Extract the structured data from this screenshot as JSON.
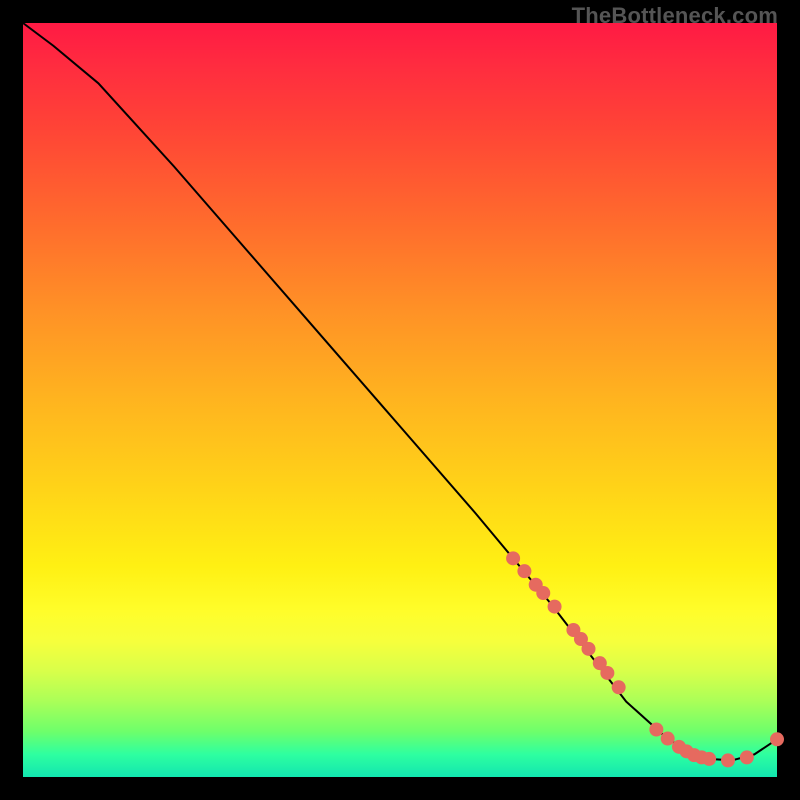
{
  "watermark": "TheBottleneck.com",
  "colors": {
    "dot": "#e66a5f",
    "curve": "#000000",
    "plot_outline": "#000000"
  },
  "chart_data": {
    "type": "line",
    "title": "",
    "xlabel": "",
    "ylabel": "",
    "xlim": [
      0,
      100
    ],
    "ylim": [
      0,
      100
    ],
    "grid": false,
    "legend": false,
    "series": [
      {
        "name": "curve",
        "x": [
          0,
          4,
          10,
          20,
          30,
          40,
          50,
          60,
          65,
          70,
          75,
          80,
          85,
          88,
          91,
          94,
          97,
          100
        ],
        "y": [
          100,
          97,
          92,
          81,
          69.5,
          58,
          46.5,
          35,
          29,
          23,
          16.5,
          10,
          5.5,
          3.4,
          2.4,
          2.2,
          3.0,
          5.0
        ]
      }
    ],
    "markers": [
      {
        "x": 65.0,
        "y": 29.0
      },
      {
        "x": 66.5,
        "y": 27.3
      },
      {
        "x": 68.0,
        "y": 25.5
      },
      {
        "x": 69.0,
        "y": 24.4
      },
      {
        "x": 70.5,
        "y": 22.6
      },
      {
        "x": 73.0,
        "y": 19.5
      },
      {
        "x": 74.0,
        "y": 18.3
      },
      {
        "x": 75.0,
        "y": 17.0
      },
      {
        "x": 76.5,
        "y": 15.1
      },
      {
        "x": 77.5,
        "y": 13.8
      },
      {
        "x": 79.0,
        "y": 11.9
      },
      {
        "x": 84.0,
        "y": 6.3
      },
      {
        "x": 85.5,
        "y": 5.1
      },
      {
        "x": 87.0,
        "y": 4.0
      },
      {
        "x": 88.0,
        "y": 3.4
      },
      {
        "x": 89.0,
        "y": 2.9
      },
      {
        "x": 90.0,
        "y": 2.6
      },
      {
        "x": 91.0,
        "y": 2.4
      },
      {
        "x": 93.5,
        "y": 2.2
      },
      {
        "x": 96.0,
        "y": 2.6
      },
      {
        "x": 100.0,
        "y": 5.0
      }
    ]
  }
}
